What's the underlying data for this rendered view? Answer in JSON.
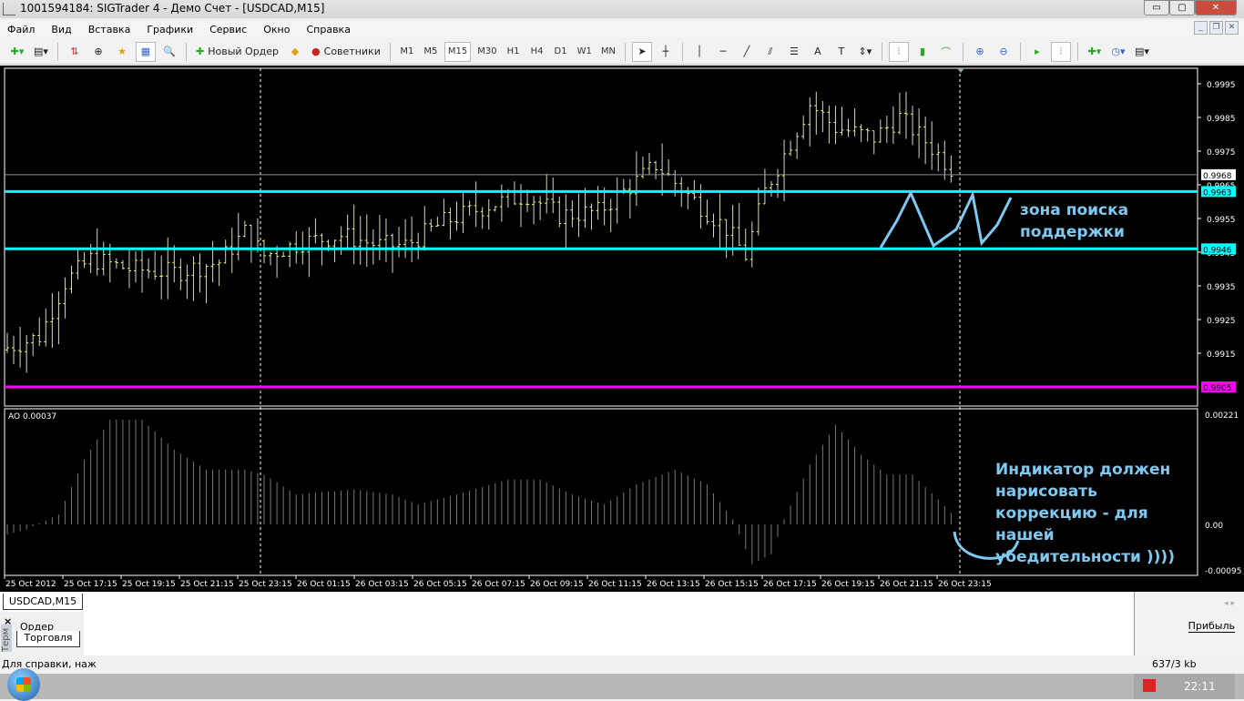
{
  "window": {
    "title": "1001594184: SIGTrader 4 - Демо Счет - [USDCAD,M15]"
  },
  "menu": [
    "Файл",
    "Вид",
    "Вставка",
    "Графики",
    "Сервис",
    "Окно",
    "Справка"
  ],
  "toolbar": {
    "new_order": "Новый Ордер",
    "advisors": "Советники",
    "timeframes": [
      "M1",
      "M5",
      "M15",
      "M30",
      "H1",
      "H4",
      "D1",
      "W1",
      "MN"
    ],
    "active_timeframe": "M15"
  },
  "chart": {
    "symbol_tab": "USDCAD,M15",
    "price_axis": [
      "0.9995",
      "0.9985",
      "0.9975",
      "0.9965",
      "0.9955",
      "0.9945",
      "0.9935",
      "0.9925",
      "0.9915"
    ],
    "price_range": [
      0.9899,
      1.0
    ],
    "current_price": "0.9968",
    "levels": [
      {
        "value": "0.9963",
        "color": "#00ffff"
      },
      {
        "value": "0.9946",
        "color": "#00ffff"
      },
      {
        "value": "0.9905",
        "color": "#ff00ff"
      }
    ],
    "time_labels": [
      "25 Oct 2012",
      "25 Oct 17:15",
      "25 Oct 19:15",
      "25 Oct 21:15",
      "25 Oct 23:15",
      "26 Oct 01:15",
      "26 Oct 03:15",
      "26 Oct 05:15",
      "26 Oct 07:15",
      "26 Oct 09:15",
      "26 Oct 11:15",
      "26 Oct 13:15",
      "26 Oct 15:15",
      "26 Oct 17:15",
      "26 Oct 19:15",
      "26 Oct 21:15",
      "26 Oct 23:15"
    ],
    "bar_count": 148,
    "price_anchors": [
      [
        0,
        0.9916
      ],
      [
        6,
        0.992
      ],
      [
        10,
        0.9936
      ],
      [
        14,
        0.9943
      ],
      [
        20,
        0.994
      ],
      [
        27,
        0.9939
      ],
      [
        34,
        0.9942
      ],
      [
        38,
        0.9951
      ],
      [
        41,
        0.9944
      ],
      [
        47,
        0.9948
      ],
      [
        53,
        0.995
      ],
      [
        59,
        0.9947
      ],
      [
        63,
        0.9947
      ],
      [
        69,
        0.9954
      ],
      [
        76,
        0.9959
      ],
      [
        82,
        0.9962
      ],
      [
        87,
        0.9956
      ],
      [
        93,
        0.9957
      ],
      [
        99,
        0.9966
      ],
      [
        102,
        0.9971
      ],
      [
        107,
        0.9962
      ],
      [
        113,
        0.9952
      ],
      [
        116,
        0.9944
      ],
      [
        119,
        0.9963
      ],
      [
        122,
        0.9974
      ],
      [
        126,
        0.9989
      ],
      [
        130,
        0.9982
      ],
      [
        136,
        0.9979
      ],
      [
        140,
        0.9985
      ],
      [
        144,
        0.9978
      ],
      [
        148,
        0.997
      ]
    ],
    "annotation_zone": "зона поиска поддержки",
    "annotation_indicator": "Индикатор должен нарисовать коррекцию - для нашей убедительности ))))"
  },
  "indicator": {
    "label": "AO 0.00037",
    "axis": [
      "0.00221",
      "0.00",
      "-0.00095"
    ],
    "range": [
      -0.00095,
      0.00221
    ],
    "anchors": [
      [
        0,
        -0.0002
      ],
      [
        3,
        -0.0001
      ],
      [
        8,
        0.0002
      ],
      [
        12,
        0.0013
      ],
      [
        16,
        0.0021
      ],
      [
        21,
        0.0021
      ],
      [
        26,
        0.0015
      ],
      [
        31,
        0.0011
      ],
      [
        37,
        0.0011
      ],
      [
        40,
        0.001
      ],
      [
        45,
        0.0006
      ],
      [
        54,
        0.0007
      ],
      [
        60,
        0.0006
      ],
      [
        64,
        0.0004
      ],
      [
        70,
        0.0006
      ],
      [
        78,
        0.0009
      ],
      [
        83,
        0.0009
      ],
      [
        88,
        0.0006
      ],
      [
        93,
        0.0004
      ],
      [
        98,
        0.0008
      ],
      [
        104,
        0.0011
      ],
      [
        109,
        0.0008
      ],
      [
        113,
        0.0001
      ],
      [
        116,
        -0.0008
      ],
      [
        119,
        -0.0006
      ],
      [
        121,
        0.0001
      ],
      [
        125,
        0.0012
      ],
      [
        129,
        0.002
      ],
      [
        133,
        0.0014
      ],
      [
        137,
        0.001
      ],
      [
        141,
        0.001
      ],
      [
        145,
        0.0005
      ],
      [
        148,
        0.0001
      ]
    ]
  },
  "bottom": {
    "terminal_tab": "Терм",
    "order_tab": "Ордер",
    "trade_tab": "Торговля",
    "profit_col": "Прибыль",
    "status_help": "Для справки, наж",
    "traffic": "637/3 kb",
    "clock": "22:11"
  }
}
